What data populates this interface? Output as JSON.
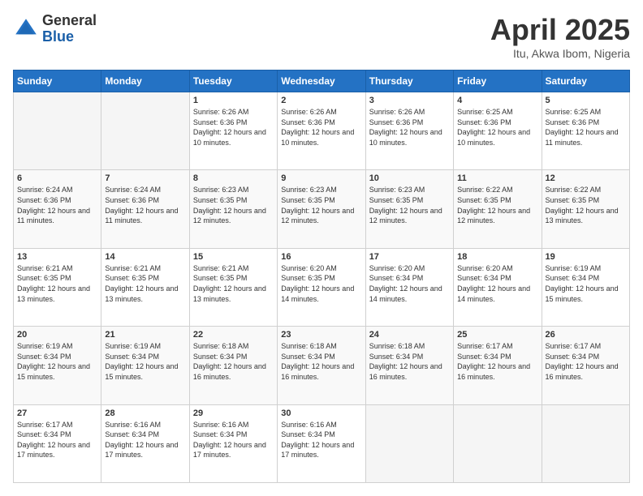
{
  "logo": {
    "general": "General",
    "blue": "Blue"
  },
  "header": {
    "month": "April 2025",
    "location": "Itu, Akwa Ibom, Nigeria"
  },
  "weekdays": [
    "Sunday",
    "Monday",
    "Tuesday",
    "Wednesday",
    "Thursday",
    "Friday",
    "Saturday"
  ],
  "weeks": [
    [
      {
        "day": "",
        "info": ""
      },
      {
        "day": "",
        "info": ""
      },
      {
        "day": "1",
        "sunrise": "Sunrise: 6:26 AM",
        "sunset": "Sunset: 6:36 PM",
        "daylight": "Daylight: 12 hours and 10 minutes."
      },
      {
        "day": "2",
        "sunrise": "Sunrise: 6:26 AM",
        "sunset": "Sunset: 6:36 PM",
        "daylight": "Daylight: 12 hours and 10 minutes."
      },
      {
        "day": "3",
        "sunrise": "Sunrise: 6:26 AM",
        "sunset": "Sunset: 6:36 PM",
        "daylight": "Daylight: 12 hours and 10 minutes."
      },
      {
        "day": "4",
        "sunrise": "Sunrise: 6:25 AM",
        "sunset": "Sunset: 6:36 PM",
        "daylight": "Daylight: 12 hours and 10 minutes."
      },
      {
        "day": "5",
        "sunrise": "Sunrise: 6:25 AM",
        "sunset": "Sunset: 6:36 PM",
        "daylight": "Daylight: 12 hours and 11 minutes."
      }
    ],
    [
      {
        "day": "6",
        "sunrise": "Sunrise: 6:24 AM",
        "sunset": "Sunset: 6:36 PM",
        "daylight": "Daylight: 12 hours and 11 minutes."
      },
      {
        "day": "7",
        "sunrise": "Sunrise: 6:24 AM",
        "sunset": "Sunset: 6:36 PM",
        "daylight": "Daylight: 12 hours and 11 minutes."
      },
      {
        "day": "8",
        "sunrise": "Sunrise: 6:23 AM",
        "sunset": "Sunset: 6:35 PM",
        "daylight": "Daylight: 12 hours and 12 minutes."
      },
      {
        "day": "9",
        "sunrise": "Sunrise: 6:23 AM",
        "sunset": "Sunset: 6:35 PM",
        "daylight": "Daylight: 12 hours and 12 minutes."
      },
      {
        "day": "10",
        "sunrise": "Sunrise: 6:23 AM",
        "sunset": "Sunset: 6:35 PM",
        "daylight": "Daylight: 12 hours and 12 minutes."
      },
      {
        "day": "11",
        "sunrise": "Sunrise: 6:22 AM",
        "sunset": "Sunset: 6:35 PM",
        "daylight": "Daylight: 12 hours and 12 minutes."
      },
      {
        "day": "12",
        "sunrise": "Sunrise: 6:22 AM",
        "sunset": "Sunset: 6:35 PM",
        "daylight": "Daylight: 12 hours and 13 minutes."
      }
    ],
    [
      {
        "day": "13",
        "sunrise": "Sunrise: 6:21 AM",
        "sunset": "Sunset: 6:35 PM",
        "daylight": "Daylight: 12 hours and 13 minutes."
      },
      {
        "day": "14",
        "sunrise": "Sunrise: 6:21 AM",
        "sunset": "Sunset: 6:35 PM",
        "daylight": "Daylight: 12 hours and 13 minutes."
      },
      {
        "day": "15",
        "sunrise": "Sunrise: 6:21 AM",
        "sunset": "Sunset: 6:35 PM",
        "daylight": "Daylight: 12 hours and 13 minutes."
      },
      {
        "day": "16",
        "sunrise": "Sunrise: 6:20 AM",
        "sunset": "Sunset: 6:35 PM",
        "daylight": "Daylight: 12 hours and 14 minutes."
      },
      {
        "day": "17",
        "sunrise": "Sunrise: 6:20 AM",
        "sunset": "Sunset: 6:34 PM",
        "daylight": "Daylight: 12 hours and 14 minutes."
      },
      {
        "day": "18",
        "sunrise": "Sunrise: 6:20 AM",
        "sunset": "Sunset: 6:34 PM",
        "daylight": "Daylight: 12 hours and 14 minutes."
      },
      {
        "day": "19",
        "sunrise": "Sunrise: 6:19 AM",
        "sunset": "Sunset: 6:34 PM",
        "daylight": "Daylight: 12 hours and 15 minutes."
      }
    ],
    [
      {
        "day": "20",
        "sunrise": "Sunrise: 6:19 AM",
        "sunset": "Sunset: 6:34 PM",
        "daylight": "Daylight: 12 hours and 15 minutes."
      },
      {
        "day": "21",
        "sunrise": "Sunrise: 6:19 AM",
        "sunset": "Sunset: 6:34 PM",
        "daylight": "Daylight: 12 hours and 15 minutes."
      },
      {
        "day": "22",
        "sunrise": "Sunrise: 6:18 AM",
        "sunset": "Sunset: 6:34 PM",
        "daylight": "Daylight: 12 hours and 16 minutes."
      },
      {
        "day": "23",
        "sunrise": "Sunrise: 6:18 AM",
        "sunset": "Sunset: 6:34 PM",
        "daylight": "Daylight: 12 hours and 16 minutes."
      },
      {
        "day": "24",
        "sunrise": "Sunrise: 6:18 AM",
        "sunset": "Sunset: 6:34 PM",
        "daylight": "Daylight: 12 hours and 16 minutes."
      },
      {
        "day": "25",
        "sunrise": "Sunrise: 6:17 AM",
        "sunset": "Sunset: 6:34 PM",
        "daylight": "Daylight: 12 hours and 16 minutes."
      },
      {
        "day": "26",
        "sunrise": "Sunrise: 6:17 AM",
        "sunset": "Sunset: 6:34 PM",
        "daylight": "Daylight: 12 hours and 16 minutes."
      }
    ],
    [
      {
        "day": "27",
        "sunrise": "Sunrise: 6:17 AM",
        "sunset": "Sunset: 6:34 PM",
        "daylight": "Daylight: 12 hours and 17 minutes."
      },
      {
        "day": "28",
        "sunrise": "Sunrise: 6:16 AM",
        "sunset": "Sunset: 6:34 PM",
        "daylight": "Daylight: 12 hours and 17 minutes."
      },
      {
        "day": "29",
        "sunrise": "Sunrise: 6:16 AM",
        "sunset": "Sunset: 6:34 PM",
        "daylight": "Daylight: 12 hours and 17 minutes."
      },
      {
        "day": "30",
        "sunrise": "Sunrise: 6:16 AM",
        "sunset": "Sunset: 6:34 PM",
        "daylight": "Daylight: 12 hours and 17 minutes."
      },
      {
        "day": "",
        "info": ""
      },
      {
        "day": "",
        "info": ""
      },
      {
        "day": "",
        "info": ""
      }
    ]
  ]
}
